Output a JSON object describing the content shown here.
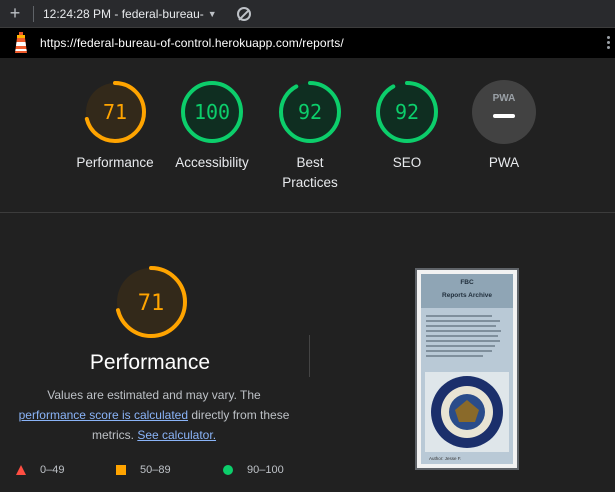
{
  "toolbar": {
    "new_label": "+",
    "session_label": "12:24:28 PM - federal-bureau-",
    "caret": "▼"
  },
  "urlbar": {
    "url": "https://federal-bureau-of-control.herokuapp.com/reports/"
  },
  "gauges": [
    {
      "label": "Performance",
      "score": 71,
      "fraction": 0.71,
      "color": "#ffa400",
      "fill": "#33291a"
    },
    {
      "label": "Accessibility",
      "score": 100,
      "fraction": 1.0,
      "color": "#0cce6b",
      "fill": "#0f2e21"
    },
    {
      "label": "Best Practices",
      "score": 92,
      "fraction": 0.92,
      "color": "#0cce6b",
      "fill": "#0f2e21"
    },
    {
      "label": "SEO",
      "score": 92,
      "fraction": 0.92,
      "color": "#0cce6b",
      "fill": "#0f2e21"
    },
    {
      "label": "PWA",
      "badge": "PWA",
      "color": "#9aa0a6",
      "fill": "#424242"
    }
  ],
  "performance": {
    "score": 71,
    "fraction": 0.71,
    "title": "Performance",
    "desc_pre": "Values are estimated and may vary. The",
    "desc_link": "performance score is calculated",
    "desc_mid": "directly from these metrics.",
    "desc_link2": "See calculator."
  },
  "legend": [
    {
      "range": "0–49",
      "shape": "triangle",
      "color": "#ff4e42"
    },
    {
      "range": "50–89",
      "shape": "square",
      "color": "#ffa400"
    },
    {
      "range": "90–100",
      "shape": "circle",
      "color": "#0cce6b"
    }
  ],
  "screenshot": {
    "brand": "FBC",
    "heading": "Reports Archive",
    "footer": "Author: Jesse F."
  }
}
